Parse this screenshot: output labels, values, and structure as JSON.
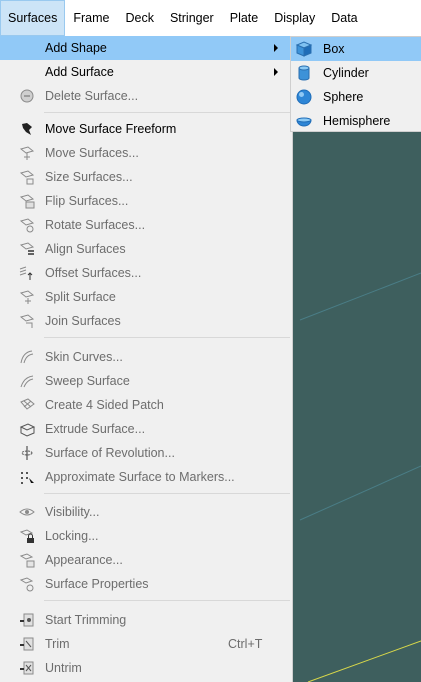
{
  "menubar": {
    "items": [
      "Surfaces",
      "Frame",
      "Deck",
      "Stringer",
      "Plate",
      "Display",
      "Data"
    ]
  },
  "menu": {
    "add_shape": "Add Shape",
    "add_surface": "Add Surface",
    "delete_surface": "Delete Surface...",
    "move_surface_freeform": "Move Surface Freeform",
    "move_surfaces": "Move Surfaces...",
    "size_surfaces": "Size Surfaces...",
    "flip_surfaces": "Flip Surfaces...",
    "rotate_surfaces": "Rotate Surfaces...",
    "align_surfaces": "Align Surfaces",
    "offset_surfaces": "Offset Surfaces...",
    "split_surface": "Split Surface",
    "join_surfaces": "Join Surfaces",
    "skin_curves": "Skin Curves...",
    "sweep_surface": "Sweep Surface",
    "create_4_sided_patch": "Create 4 Sided Patch",
    "extrude_surface": "Extrude Surface...",
    "surface_of_revolution": "Surface of Revolution...",
    "approximate_surface": "Approximate Surface to Markers...",
    "visibility": "Visibility...",
    "locking": "Locking...",
    "appearance": "Appearance...",
    "surface_properties": "Surface Properties",
    "start_trimming": "Start Trimming",
    "trim": "Trim",
    "trim_shortcut": "Ctrl+T",
    "untrim": "Untrim"
  },
  "submenu": {
    "box": "Box",
    "cylinder": "Cylinder",
    "sphere": "Sphere",
    "hemisphere": "Hemisphere"
  },
  "colors": {
    "highlight": "#91c9f7",
    "menu_bg": "#f0f0f0",
    "viewport_bg": "#3e5f5e"
  }
}
